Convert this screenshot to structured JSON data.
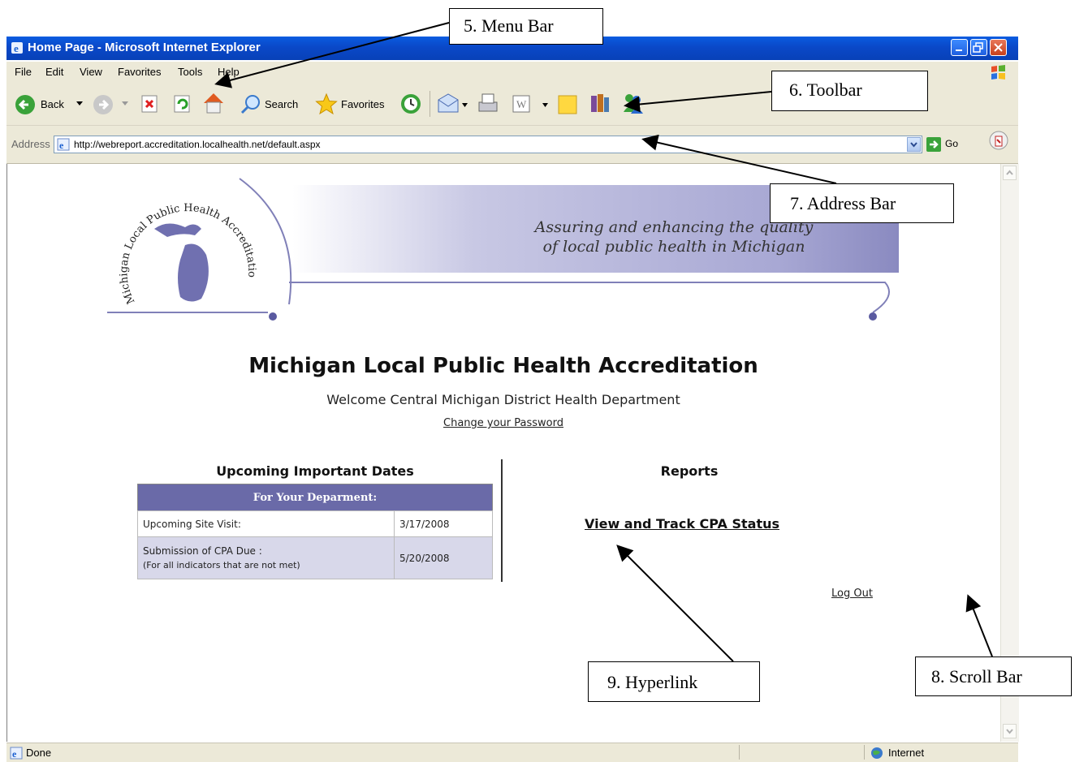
{
  "window": {
    "title": "Home Page - Microsoft Internet Explorer"
  },
  "menu": {
    "items": [
      "File",
      "Edit",
      "View",
      "Favorites",
      "Tools",
      "Help"
    ]
  },
  "toolbar": {
    "back_label": "Back",
    "search_label": "Search",
    "favorites_label": "Favorites"
  },
  "address": {
    "label": "Address",
    "url": "http://webreport.accreditation.localhealth.net/default.aspx",
    "go_label": "Go"
  },
  "banner": {
    "logo_text": "Michigan Local Public Health Accreditation Program",
    "tagline_line1": "Assuring and enhancing the quality",
    "tagline_line2": "of local public health in Michigan"
  },
  "page": {
    "title": "Michigan Local Public Health Accreditation",
    "welcome": "Welcome Central Michigan District Health Department",
    "change_password": "Change your Password",
    "log_out": "Log Out"
  },
  "dates_section": {
    "heading": "Upcoming Important Dates",
    "table_header": "For Your Deparment:",
    "rows": [
      {
        "label": "Upcoming Site Visit:",
        "note": "",
        "date": "3/17/2008"
      },
      {
        "label": "Submission of CPA Due :",
        "note": "(For all indicators that are not met)",
        "date": "5/20/2008"
      }
    ]
  },
  "reports_section": {
    "heading": "Reports",
    "link": "View and Track CPA Status"
  },
  "status": {
    "left": "Done",
    "zone": "Internet"
  },
  "callouts": {
    "menu_bar": "5. Menu Bar",
    "toolbar": "6. Toolbar",
    "address_bar": "7. Address Bar",
    "scroll_bar": "8. Scroll Bar",
    "hyperlink": "9. Hyperlink"
  },
  "colors": {
    "titlebar": "#0a48c8",
    "chrome": "#ece9d8",
    "table_header": "#6a6aa8",
    "table_alt_row": "#d8d8ea",
    "banner_purple": "#8a8ac0"
  }
}
